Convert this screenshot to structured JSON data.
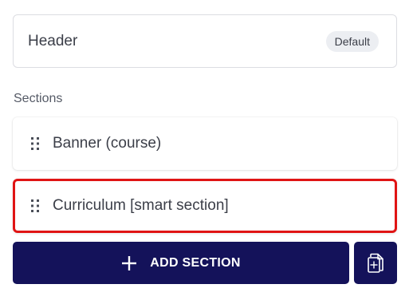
{
  "header": {
    "title": "Header",
    "badge": "Default"
  },
  "sections": {
    "label": "Sections",
    "items": [
      {
        "label": "Banner (course)",
        "highlighted": false
      },
      {
        "label": "Curriculum [smart section]",
        "highlighted": true
      }
    ]
  },
  "actions": {
    "add_label": "ADD SECTION",
    "add_icon": "plus-icon",
    "copy_icon": "duplicate-page-icon"
  },
  "colors": {
    "primary_button": "#14125a",
    "highlight_border": "#e01414",
    "text": "#3b3e48"
  }
}
